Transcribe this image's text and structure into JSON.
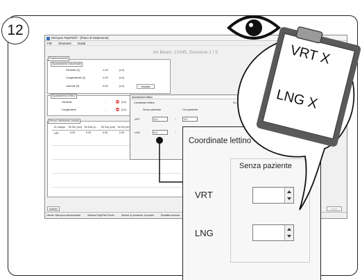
{
  "step_number": "12",
  "window": {
    "title": "Micropos RayPilot® - [Piano di trattamento]",
    "menu": [
      "File",
      "Strumenti",
      "Guida"
    ],
    "session_header": "Jm Beam, 12345, Sessione 1 / 5"
  },
  "panel_main": {
    "group_posizionamento": "Posizionamento",
    "group_spostamento_trasv": "Spostamento trasversale",
    "rows": [
      {
        "label": "Verticale (1)",
        "value": "-1.00",
        "unit": "[cm]"
      },
      {
        "label": "Longitudinale (2)",
        "value": "-1.00",
        "unit": "[cm]"
      },
      {
        "label": "Laterale (3)",
        "value": "-3.00",
        "unit": "[cm]"
      }
    ],
    "button_imposta": "Imposta",
    "group_spostamento_lettino": "Spostamento lettino",
    "lettino_rows": [
      {
        "label": "Verticale",
        "value": "-",
        "unit": "[cm]"
      },
      {
        "label": "Longitudinal",
        "value": "-",
        "unit": "[cm]"
      }
    ]
  },
  "table": {
    "title": "Elenco riferimento campo",
    "headers": [
      "ID campo",
      "Tol Sin (cm)",
      "Tol Des (c...",
      "Tol Sup (cm)",
      "Tol Inf (cm)"
    ],
    "row": [
      "Fi",
      "0.30",
      "0.30",
      "0.30",
      "0.30"
    ]
  },
  "button_indietro": "Indietro",
  "button_avanti": "Avanti",
  "statusbar": [
    "Utente: Micropos Administrator",
    "Sistema RayPilot Pronto",
    "Motore di posizione: Accolato",
    "Modalità sistema: ..."
  ],
  "small_dialog": {
    "title": "Spostamento lettino",
    "group": "Coordinate lettino",
    "col1": "Senza paziente",
    "col2": "Con paziente",
    "col3": "So",
    "rows": [
      {
        "label": "VRT",
        "v1": "0.0",
        "v2": "0.0"
      },
      {
        "label": "LNG",
        "v1": "0.0",
        "v2": "0.0"
      }
    ]
  },
  "zoom": {
    "title": "Coordinate lettino",
    "subheader": "Senza paziente",
    "label_vrt": "VRT",
    "label_lng": "LNG"
  },
  "clipboard": {
    "line1": "VRT X",
    "line2": "LNG X"
  },
  "colors": {
    "red_indicator": "#e23b3b",
    "clip_dark": "#5a5a5a",
    "clip_light": "#9a9a9a"
  }
}
